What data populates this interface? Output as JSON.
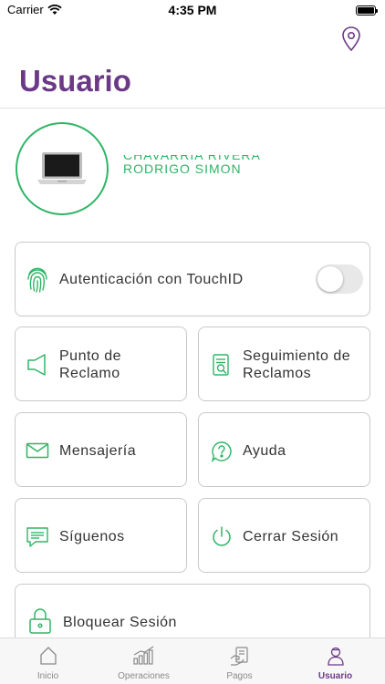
{
  "status_bar": {
    "carrier": "Carrier",
    "time": "4:35 PM"
  },
  "header": {
    "title": "Usuario",
    "location_icon": "map-pin-icon"
  },
  "profile": {
    "avatar_icon": "laptop-icon",
    "name_line1": "CHAVARRIA RIVERA",
    "name_line2": "RODRIGO SIMON"
  },
  "touchid": {
    "label": "Autenticación con TouchID",
    "icon": "fingerprint-icon",
    "enabled": false
  },
  "menu": {
    "punto_reclamo": "Punto de Reclamo",
    "seguimiento": "Seguimiento de Reclamos",
    "mensajeria": "Mensajería",
    "ayuda": "Ayuda",
    "siguenos": "Síguenos",
    "cerrar_sesion": "Cerrar Sesión",
    "bloquear_sesion": "Bloquear Sesión"
  },
  "tab_bar": {
    "tabs": [
      {
        "label": "Inicio",
        "icon": "home-icon"
      },
      {
        "label": "Operaciones",
        "icon": "chart-icon"
      },
      {
        "label": "Pagos",
        "icon": "payments-icon"
      },
      {
        "label": "Usuario",
        "icon": "user-icon",
        "active": true
      }
    ]
  },
  "colors": {
    "brand_purple": "#6b3a86",
    "accent_green": "#2fb566"
  }
}
